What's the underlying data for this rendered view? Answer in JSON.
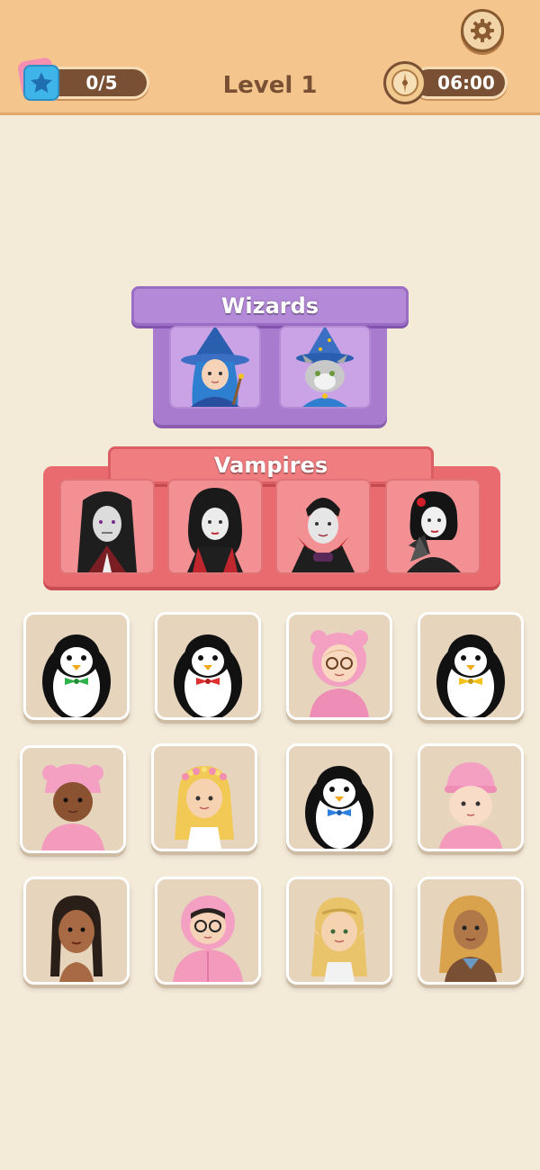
{
  "hud": {
    "stars_progress": "0/5",
    "level_title": "Level 1",
    "timer": "06:00",
    "icons": [
      "star-icon",
      "clock-icon",
      "gear-icon"
    ]
  },
  "categories": [
    {
      "name": "Wizards",
      "color": "#a97bcf",
      "slots": [
        "wizard-girl",
        "wizard-cat"
      ]
    },
    {
      "name": "Vampires",
      "color": "#ea6b6f",
      "slots": [
        "vampire-long-hair",
        "vampire-woman",
        "vampire-classic",
        "vampire-lady-with-fan"
      ]
    }
  ],
  "board": {
    "tiles": [
      {
        "id": "penguin-green-bowtie",
        "accent": "#2fb24a"
      },
      {
        "id": "penguin-red-bowtie",
        "accent": "#e02f2f"
      },
      {
        "id": "girl-pink-bear-hood-glasses",
        "accent": "#f3a0c2"
      },
      {
        "id": "penguin-yellow-bowtie",
        "accent": "#f3c21b"
      },
      {
        "id": "girl-pink-bear-hat",
        "accent": "#f3a0c2"
      },
      {
        "id": "flower-crown-girl",
        "accent": "#f2c955"
      },
      {
        "id": "penguin-blue-bowtie",
        "accent": "#2e7fe0"
      },
      {
        "id": "baby-pink-beanie",
        "accent": "#f3a0c2"
      },
      {
        "id": "braids-girl",
        "accent": "#3a2a20"
      },
      {
        "id": "boy-pink-hoodie-glasses",
        "accent": "#f3a0c2"
      },
      {
        "id": "elf-girl",
        "accent": "#e9c46a"
      },
      {
        "id": "braided-woman",
        "accent": "#d9a24c"
      }
    ]
  }
}
